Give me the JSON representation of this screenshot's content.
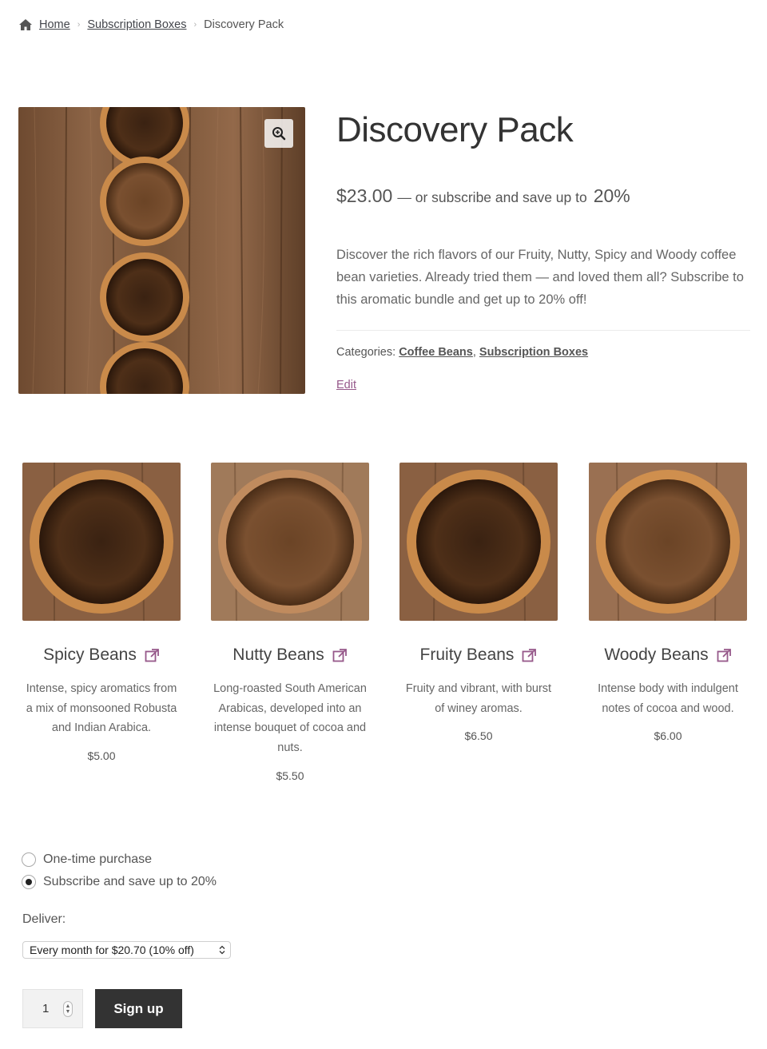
{
  "breadcrumb": {
    "home_icon": "home-icon",
    "home": "Home",
    "category": "Subscription Boxes",
    "current": "Discovery Pack",
    "separator": "›"
  },
  "product": {
    "title": "Discovery Pack",
    "price": "$23.00",
    "price_suffix": "— or subscribe and save up to",
    "discount": "20%",
    "description": "Discover the rich flavors of our Fruity, Nutty, Spicy and Woody coffee bean varieties. Already tried them — and loved them all? Subscribe to this aromatic bundle and get up to 20% off!",
    "categories_label": "Categories:",
    "categories": [
      "Coffee Beans",
      "Subscription Boxes"
    ],
    "categories_sep": ",",
    "edit_label": "Edit",
    "zoom_icon": "zoom-in-icon"
  },
  "bundle_items": [
    {
      "name": "Spicy Beans",
      "description": "Intense, spicy aromatics from a mix of monsooned Robusta and Indian Arabica.",
      "price": "$5.00"
    },
    {
      "name": "Nutty Beans",
      "description": "Long-roasted South American Arabicas, developed into an intense bouquet of cocoa and nuts.",
      "price": "$5.50"
    },
    {
      "name": "Fruity Beans",
      "description": "Fruity and vibrant, with burst of winey aromas.",
      "price": "$6.50"
    },
    {
      "name": "Woody Beans",
      "description": "Intense body with indulgent notes of cocoa and wood.",
      "price": "$6.00"
    }
  ],
  "purchase": {
    "one_time": "One-time purchase",
    "subscribe": "Subscribe and save up to 20%",
    "selected": "subscribe",
    "deliver_label": "Deliver:",
    "deliver_selected": "Every month for $20.70 (10% off)",
    "quantity": "1",
    "signup_label": "Sign up"
  },
  "colors": {
    "accent": "#96588a",
    "button": "#333333",
    "text": "#43454b"
  }
}
